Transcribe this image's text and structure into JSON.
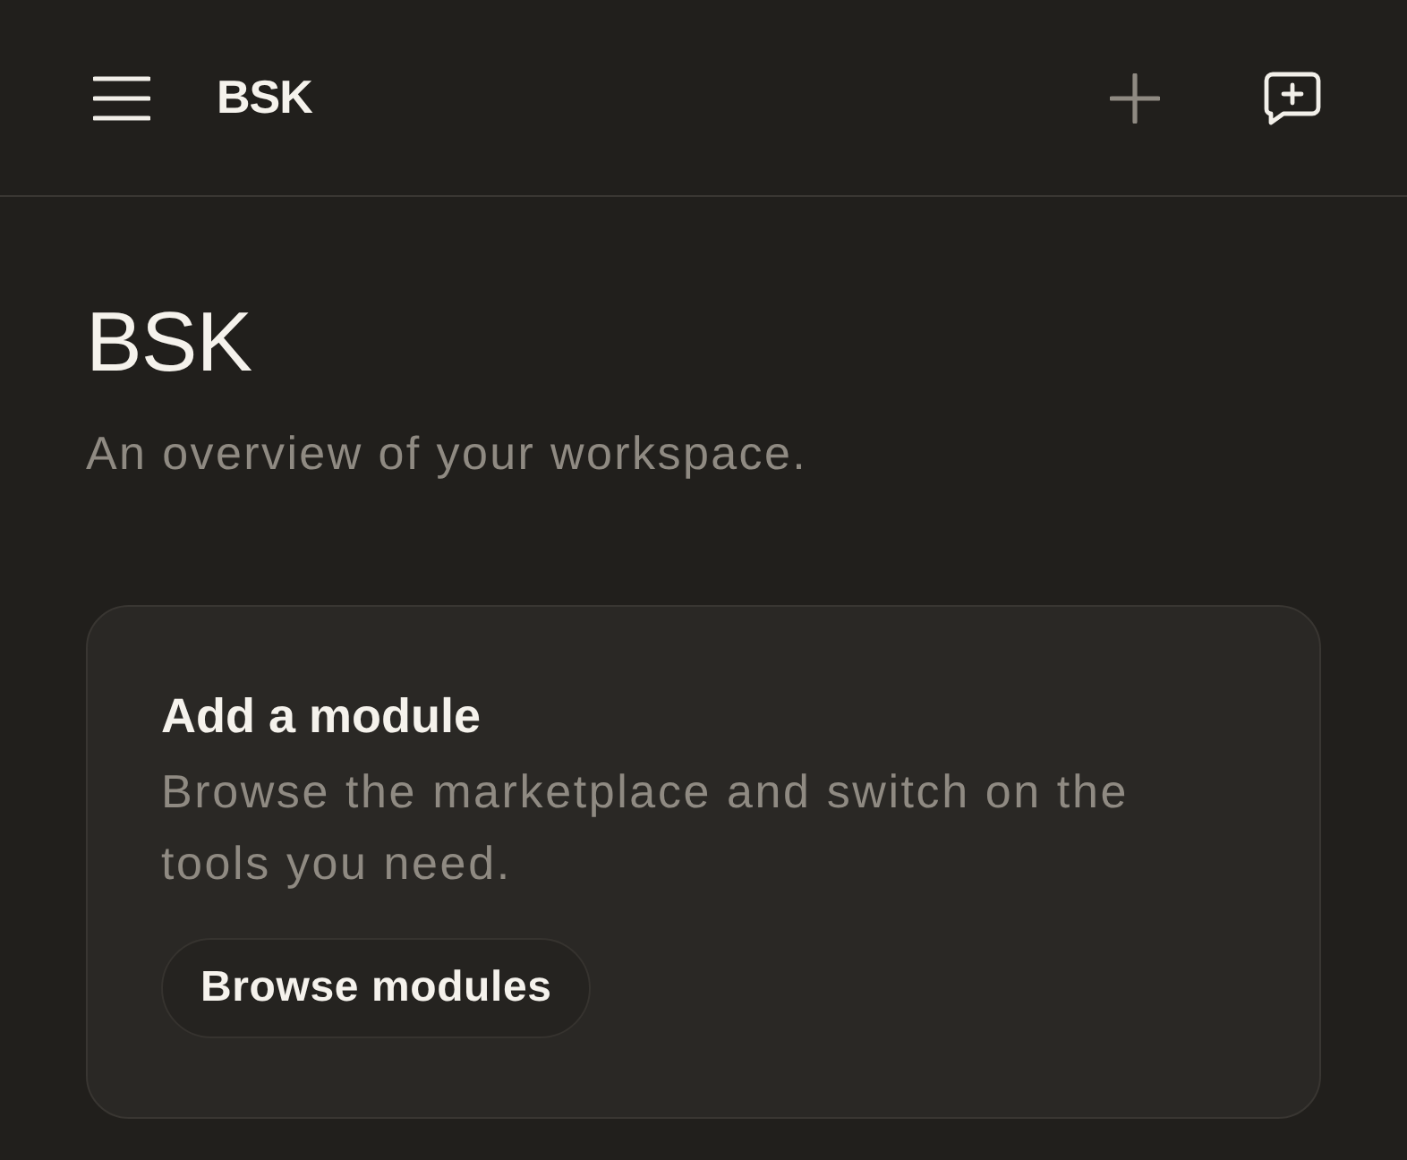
{
  "header": {
    "title": "BSK"
  },
  "page": {
    "title": "BSK",
    "subtitle": "An overview of your workspace."
  },
  "card": {
    "title": "Add a module",
    "description": "Browse the marketplace and switch on the tools you need.",
    "button": "Browse modules"
  }
}
